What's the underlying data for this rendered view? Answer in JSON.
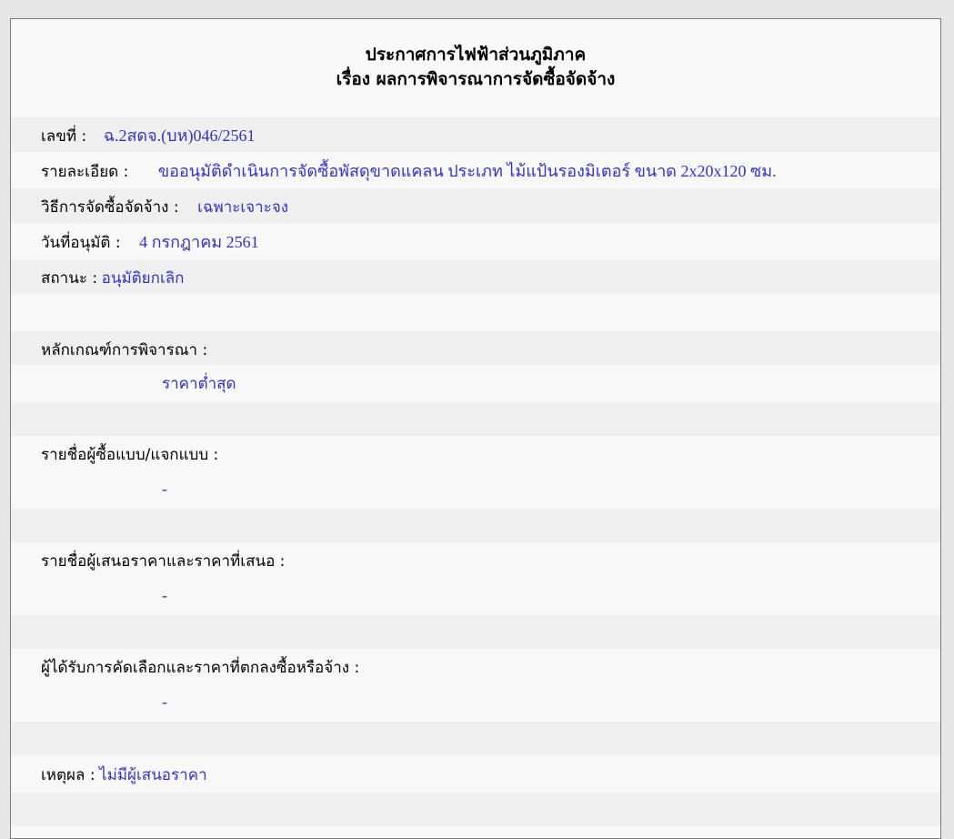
{
  "header": {
    "line1": "ประกาศการไฟฟ้าส่วนภูมิภาค",
    "line2": "เรื่อง ผลการพิจารณาการจัดซื้อจัดจ้าง"
  },
  "fields": {
    "number": {
      "label": "เลขที่ :",
      "value": "ฉ.2สดจ.(บห)046/2561"
    },
    "detail": {
      "label": "รายละเอียด :",
      "value": "ขออนุมัติดำเนินการจัดซื้อพัสดุขาดแคลน ประเภท ไม้แป้นรองมิเตอร์ ขนาด 2x20x120 ซม."
    },
    "method": {
      "label": "วิธีการจัดซื้อจัดจ้าง :",
      "value": "เฉพาะเจาะจง"
    },
    "approval_date": {
      "label": "วันที่อนุมัติ :",
      "value": "4 กรกฎาคม 2561"
    },
    "status": {
      "label": "สถานะ :",
      "value": "อนุมัติยกเลิก"
    }
  },
  "criteria": {
    "label": "หลักเกณฑ์การพิจารณา :",
    "value": "ราคาต่ำสุด"
  },
  "buyers": {
    "label": "รายชื่อผู้ซื้อแบบ/แจกแบบ :",
    "value": "-"
  },
  "bidders": {
    "label": "รายชื่อผู้เสนอราคาและราคาที่เสนอ :",
    "value": "-"
  },
  "winner": {
    "label": "ผู้ได้รับการคัดเลือกและราคาที่ตกลงซื้อหรือจ้าง :",
    "value": "-"
  },
  "reason": {
    "label": "เหตุผล :",
    "value": "ไม่มีผู้เสนอราคา"
  }
}
